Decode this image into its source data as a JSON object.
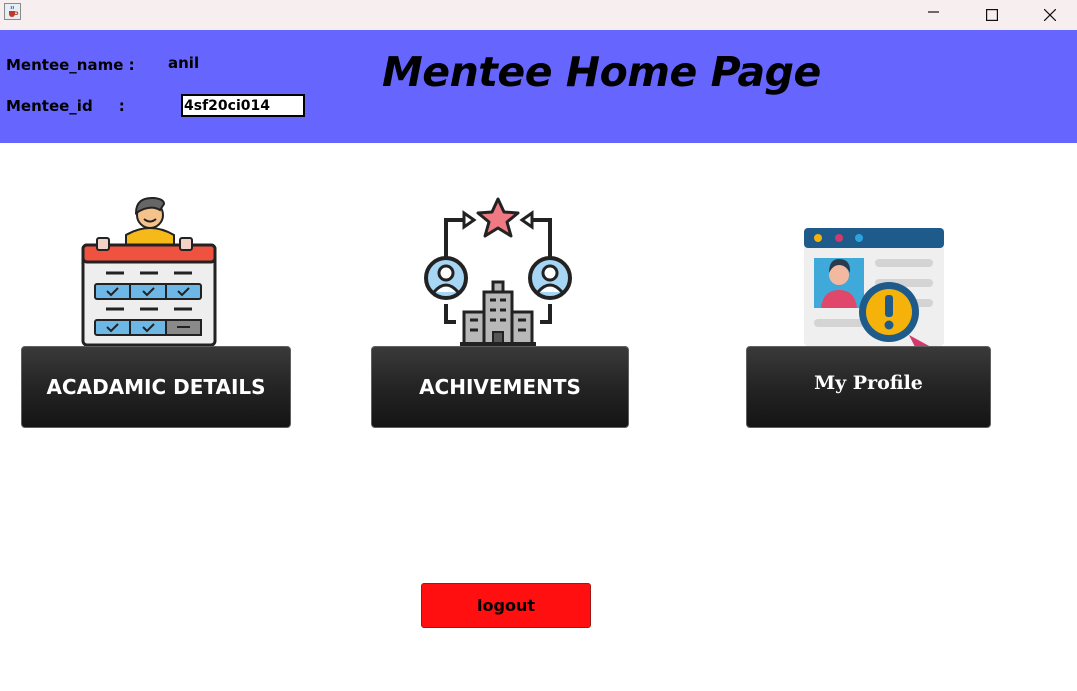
{
  "window": {
    "app_icon": "java-cup-icon",
    "controls": [
      "minimize-icon",
      "maximize-icon",
      "close-icon"
    ]
  },
  "header": {
    "background": "#6666ff",
    "title": "Mentee Home Page",
    "name_label": "Mentee_name :",
    "name_value": "anil",
    "id_label": "Mentee_id     :",
    "id_value": "4sf20ci014"
  },
  "tiles": [
    {
      "label": "ACADAMIC DETAILS",
      "icon": "academic-details-icon"
    },
    {
      "label": "ACHIVEMENTS",
      "icon": "achievements-icon"
    },
    {
      "label": "My Profile",
      "icon": "profile-icon"
    }
  ],
  "logout": {
    "label": "logout",
    "color": "#ff0f0f"
  }
}
